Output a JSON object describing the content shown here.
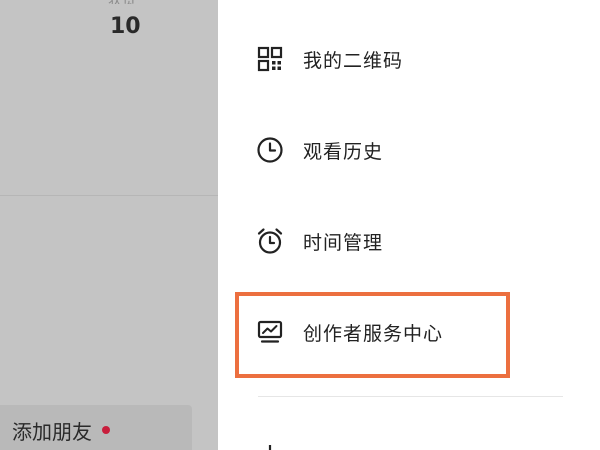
{
  "background": {
    "stat_label": "获赞",
    "stat_value": "10",
    "add_friend_label": "添加朋友"
  },
  "drawer": {
    "items": [
      {
        "label": "我的二维码",
        "icon": "qr-code-icon"
      },
      {
        "label": "观看历史",
        "icon": "clock-icon"
      },
      {
        "label": "时间管理",
        "icon": "alarm-clock-icon"
      },
      {
        "label": "创作者服务中心",
        "icon": "creator-monitor-icon"
      }
    ]
  },
  "colors": {
    "highlight": "#ec6f3f",
    "notification_dot": "#c81e3c",
    "dim_overlay": "#c4c4c4"
  }
}
